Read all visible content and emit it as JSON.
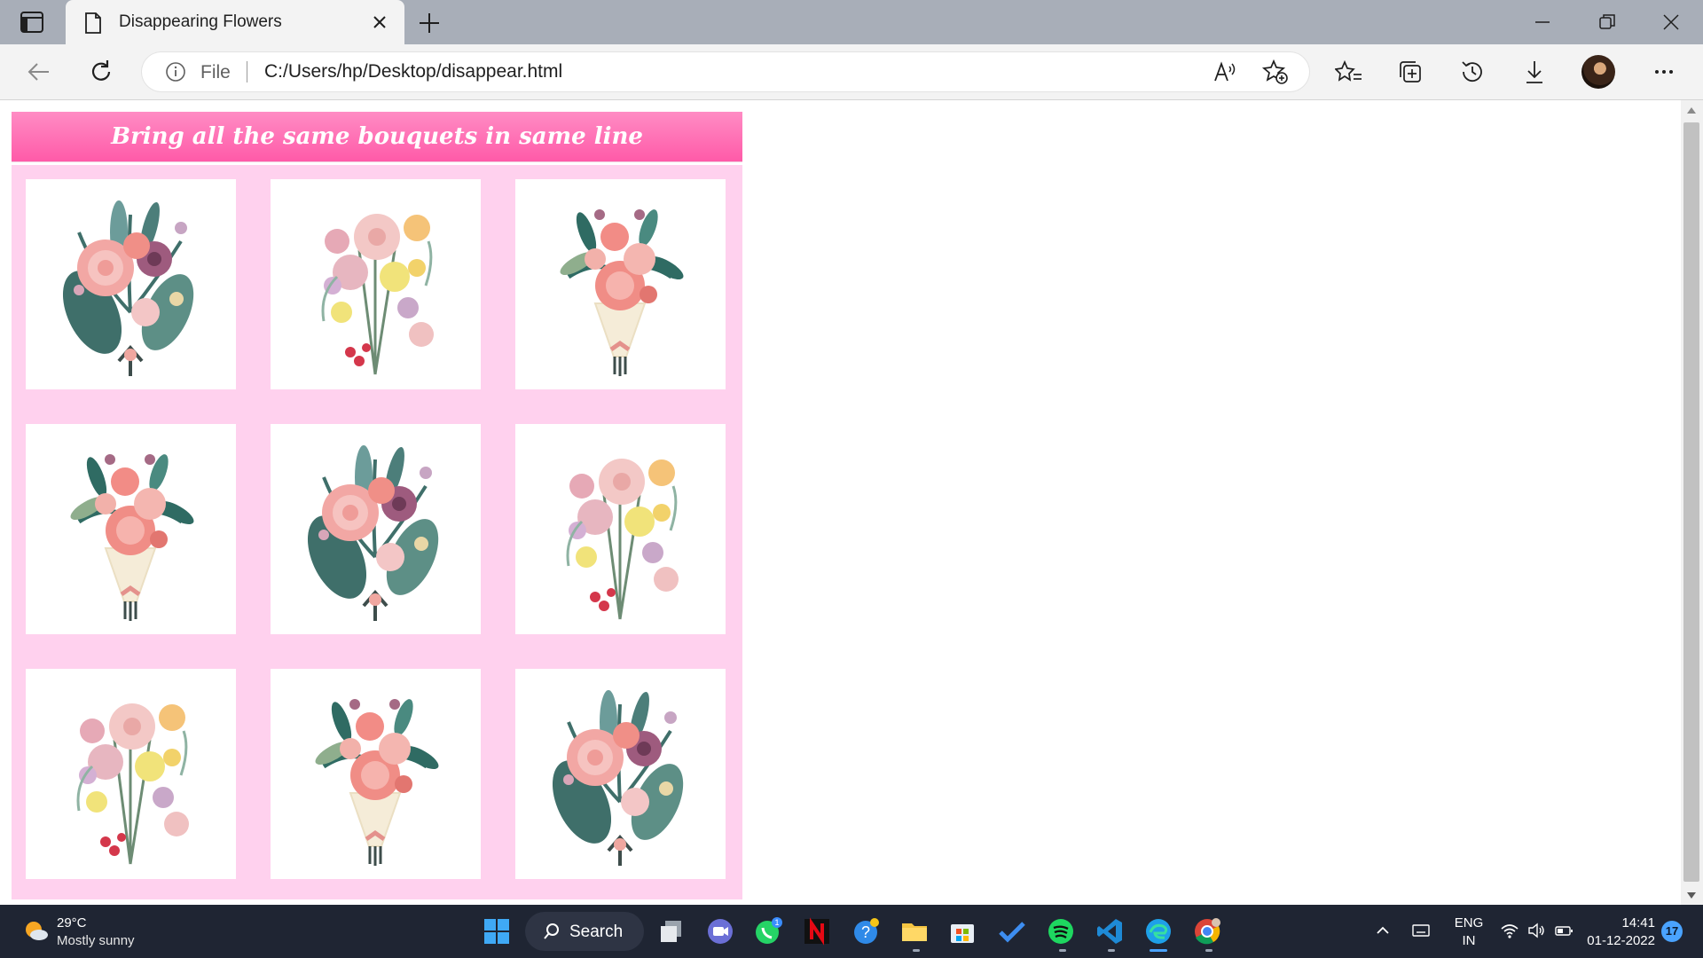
{
  "browser": {
    "tab_title": "Disappearing Flowers",
    "omnibox_scheme": "File",
    "url": "C:/Users/hp/Desktop/disappear.html"
  },
  "page": {
    "heading": "Bring all the same bouquets in same line",
    "colors": {
      "header": "#ff6fb5",
      "grid_background": "#ffd1ee",
      "card": "#ffffff"
    },
    "bouquets": [
      [
        "pink-rose-bouquet",
        "pastel-mixed-bouquet",
        "rose-paper-wrap-bouquet"
      ],
      [
        "rose-paper-wrap-bouquet",
        "pink-rose-bouquet",
        "pastel-mixed-bouquet"
      ],
      [
        "pastel-mixed-bouquet",
        "rose-paper-wrap-bouquet",
        "pink-rose-bouquet"
      ]
    ]
  },
  "taskbar": {
    "weather_temp": "29°C",
    "weather_desc": "Mostly sunny",
    "search_label": "Search",
    "whatsapp_badge": "1",
    "language_top": "ENG",
    "language_bottom": "IN",
    "time": "14:41",
    "date": "01-12-2022",
    "notifications": "17"
  }
}
